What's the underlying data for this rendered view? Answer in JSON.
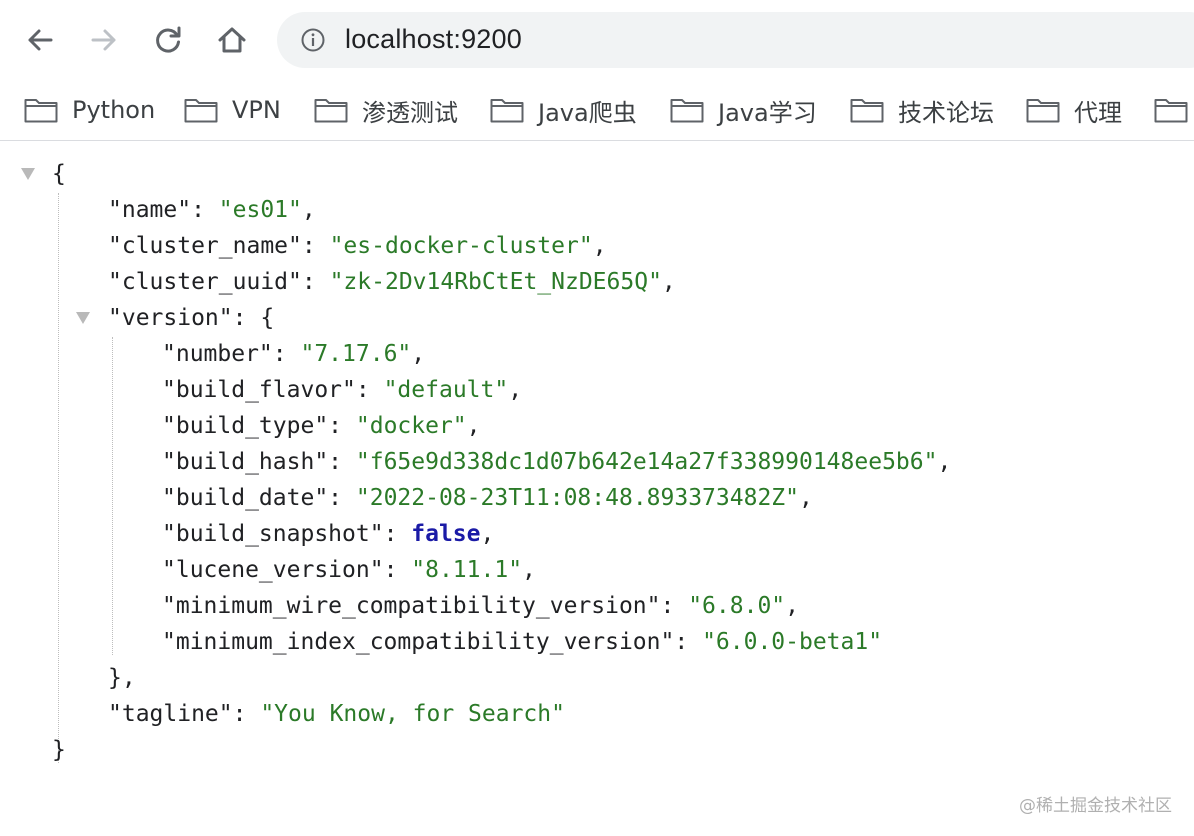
{
  "browser": {
    "url": "localhost:9200",
    "toolbar_icons": [
      "back-arrow-icon",
      "forward-arrow-icon",
      "reload-icon",
      "home-icon",
      "info-icon"
    ]
  },
  "bookmarks": [
    "Python",
    "VPN",
    "渗透测试",
    "Java爬虫",
    "Java学习",
    "技术论坛",
    "代理",
    ""
  ],
  "json": {
    "open_brace": "{",
    "close_brace": "}",
    "name_key": "\"name\"",
    "name_value": "\"es01\"",
    "cluster_name_key": "\"cluster_name\"",
    "cluster_name_value": "\"es-docker-cluster\"",
    "cluster_uuid_key": "\"cluster_uuid\"",
    "cluster_uuid_value": "\"zk-2Dv14RbCtEt_NzDE65Q\"",
    "version_key": "\"version\"",
    "version_open": "{",
    "version_close": "},",
    "number_key": "\"number\"",
    "number_value": "\"7.17.6\"",
    "build_flavor_key": "\"build_flavor\"",
    "build_flavor_value": "\"default\"",
    "build_type_key": "\"build_type\"",
    "build_type_value": "\"docker\"",
    "build_hash_key": "\"build_hash\"",
    "build_hash_value": "\"f65e9d338dc1d07b642e14a27f338990148ee5b6\"",
    "build_date_key": "\"build_date\"",
    "build_date_value": "\"2022-08-23T11:08:48.893373482Z\"",
    "build_snapshot_key": "\"build_snapshot\"",
    "build_snapshot_value": "false",
    "lucene_version_key": "\"lucene_version\"",
    "lucene_version_value": "\"8.11.1\"",
    "min_wire_key": "\"minimum_wire_compatibility_version\"",
    "min_wire_value": "\"6.8.0\"",
    "min_index_key": "\"minimum_index_compatibility_version\"",
    "min_index_value": "\"6.0.0-beta1\"",
    "tagline_key": "\"tagline\"",
    "tagline_value": "\"You Know, for Search\"",
    "colon": ": ",
    "comma": ","
  },
  "watermark": "@稀土掘金技术社区",
  "colors": {
    "string": "#2b7a28",
    "boolean": "#1a1aa6",
    "text": "#202124",
    "omnibox_bg": "#f1f3f4"
  }
}
